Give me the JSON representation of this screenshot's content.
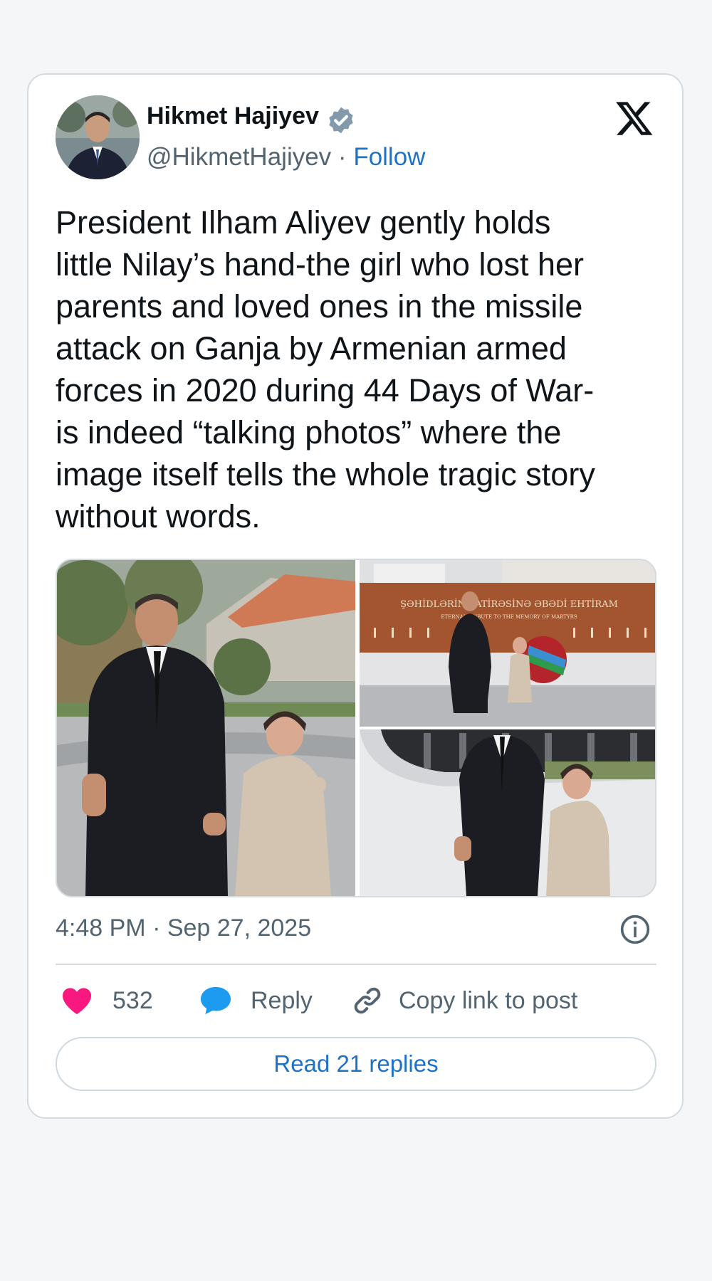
{
  "author": {
    "name": "Hikmet Hajiyev",
    "handle": "@HikmetHajiyev",
    "separator": "·",
    "follow_label": "Follow"
  },
  "tweet": {
    "text": "President Ilham Aliyev gently holds\nlittle Nilay’s hand-the girl who lost her\nparents and loved ones in the missile\nattack on Ganja by Armenian armed\nforces in 2020 during 44 Days of War-\nis indeed “talking photos” where the\nimage itself tells the whole tragic story\nwithout words.",
    "timestamp": "4:48 PM · Sep 27, 2025"
  },
  "media": {
    "memorial_inscription": "ŞƏHİDLƏRİN XATİRƏSİNƏ ƏBƏDİ EHTİRAM",
    "memorial_subtitle": "ETERNAL TRIBUTE TO THE MEMORY OF MARTYRS"
  },
  "actions": {
    "like_count": "532",
    "reply_label": "Reply",
    "copy_label": "Copy link to post",
    "read_replies_label": "Read 21 replies"
  },
  "colors": {
    "like": "#f91880",
    "reply": "#1d9bf0",
    "link": "#1d72c6",
    "verified": "#829aab",
    "text": "#0f1419",
    "muted": "#536471"
  },
  "icons": {
    "verified": "verified-badge-icon",
    "platform": "x-logo-icon",
    "info": "info-icon",
    "like": "heart-icon",
    "reply": "speech-bubble-icon",
    "copy": "link-icon"
  }
}
